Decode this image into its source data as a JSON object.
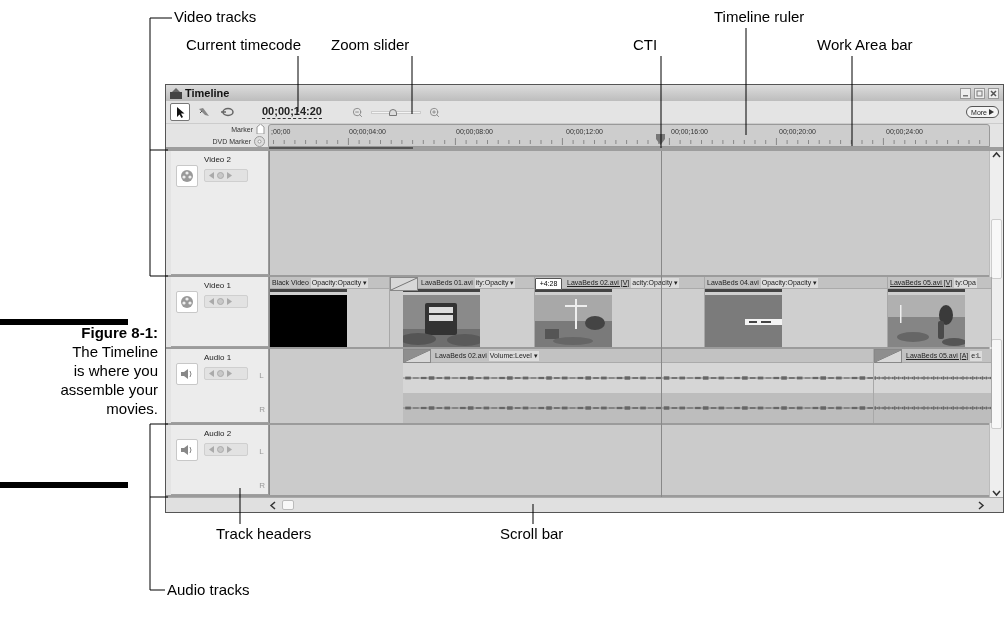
{
  "callouts_top": [
    {
      "text": "Video tracks"
    },
    {
      "text": "Timeline ruler"
    },
    {
      "text": "Current timecode"
    },
    {
      "text": "Zoom slider"
    },
    {
      "text": "CTI"
    },
    {
      "text": "Work Area bar"
    }
  ],
  "callouts_bottom": [
    {
      "text": "Track headers"
    },
    {
      "text": "Scroll bar"
    },
    {
      "text": "Audio tracks"
    }
  ],
  "caption": {
    "label": "Figure 8-1:",
    "text": "The Timeline is where you assemble your movies."
  },
  "window": {
    "title": "Timeline"
  },
  "toolbar": {
    "tools": [
      {
        "kind": "pointer",
        "selected": true
      },
      {
        "kind": "razor",
        "selected": false
      },
      {
        "kind": "hand",
        "selected": false
      }
    ],
    "timecode": "00;00;14:20",
    "zoom": {
      "level": 0.45
    },
    "more_button": "More"
  },
  "ruler": {
    "marker_label": "Marker",
    "dvd_marker_label": "DVD Marker",
    "labels": [
      ";00;00",
      "00;00;04:00",
      "00;00;08:00",
      "00;00;12:00",
      "00;00;16:00",
      "00;00;20:00",
      "00;00;24:00"
    ],
    "cti": {
      "level": 0.544
    },
    "work_area": {
      "level": 0.2
    }
  },
  "tracks": [
    {
      "kind": "video",
      "name": "Video 2"
    },
    {
      "kind": "video",
      "name": "Video 1",
      "clips": [
        {
          "kind": "solid",
          "name": "Black Video",
          "property": "Opacity:Opacity ▾",
          "linked": false
        },
        {
          "kind": "transition"
        },
        {
          "kind": "clip",
          "name": "LavaBeds 01.avi",
          "property": "ity:Opacity ▾",
          "linked": false
        },
        {
          "kind": "offset",
          "text": "+4:28"
        },
        {
          "kind": "clip",
          "name": "LavaBeds 02.avi [V]",
          "property": "acity:Opacity ▾",
          "linked": true
        },
        {
          "kind": "clip",
          "name": "LavaBeds 04.avi",
          "property": "Opacity:Opacity ▾",
          "linked": false
        },
        {
          "kind": "clip",
          "name": "LavaBeds 05.avi [V]",
          "property": "ty:Opa",
          "linked": true
        }
      ]
    },
    {
      "kind": "audio",
      "name": "Audio 1",
      "channels": [
        "L",
        "R"
      ],
      "clips": [
        {
          "kind": "transition"
        },
        {
          "kind": "clip",
          "name": "LavaBeds 02.avi",
          "property": "Volume:Level ▾",
          "linked": false
        },
        {
          "kind": "transition"
        },
        {
          "kind": "clip",
          "name": "LavaBeds 05.avi [A]",
          "property": "e:L",
          "linked": true
        }
      ]
    },
    {
      "kind": "audio",
      "name": "Audio 2",
      "channels": [
        "L",
        "R"
      ]
    }
  ]
}
